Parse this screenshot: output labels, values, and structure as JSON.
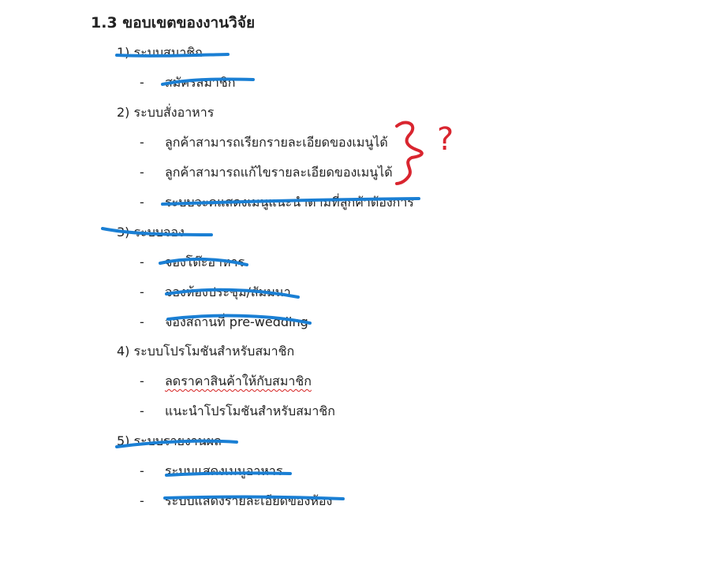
{
  "document": {
    "heading": "1.3 ขอบเขตของงานวิจัย",
    "sections": [
      {
        "label": "1)  ระบบสมาชิก",
        "items": [
          "สมัครสมาชิก"
        ]
      },
      {
        "label": "2)  ระบบสั่งอาหาร",
        "items": [
          "ลูกค้าสามารถเรียกรายละเอียดของเมนูได้",
          "ลูกค้าสามารถแก้ไขรายละเอียดของเมนูได้",
          "ระบบจะคแสดงเมนูแนะนำตามที่ลูกค้าต้องการ"
        ]
      },
      {
        "label": "3)  ระบบจอง",
        "items": [
          "จองโต๊ะอาหาร",
          "จองห้องประชุม/สัมมนา",
          "จองสถานที่ pre-wedding"
        ]
      },
      {
        "label": "4)  ระบบโปรโมชันสำหรับสมาชิก",
        "items": [
          "ลดราคาสินค้าให้กับสมาชิก",
          "แนะนำโปรโมชันสำหรับสมาชิก"
        ]
      },
      {
        "label": "5)  ระบบรายงานผล",
        "items": [
          "ระบบแสดงเมนูอาหาร",
          "ระบบแสดงรายละเอียดของห้อง"
        ]
      }
    ],
    "bullet": "-"
  },
  "annotations": {
    "question_mark": "?",
    "strike_color": "#1a7fd4",
    "note_color": "#d9252f"
  }
}
